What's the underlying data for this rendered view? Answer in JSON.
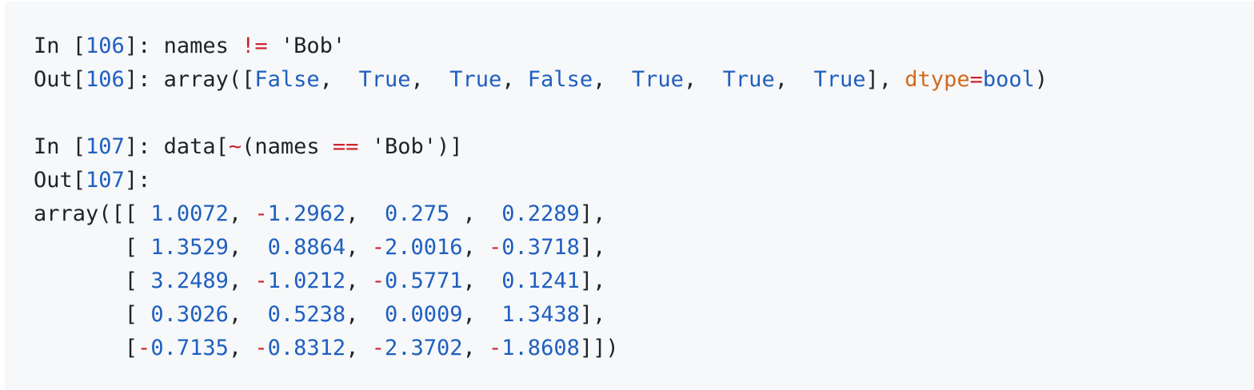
{
  "code": {
    "lines": [
      [
        {
          "t": "In [",
          "c": "p"
        },
        {
          "t": "106",
          "c": "n"
        },
        {
          "t": "]: names ",
          "c": "p"
        },
        {
          "t": "!=",
          "c": "o"
        },
        {
          "t": " 'Bob'",
          "c": "s"
        }
      ],
      [
        {
          "t": "Out[",
          "c": "p"
        },
        {
          "t": "106",
          "c": "n"
        },
        {
          "t": "]: array([",
          "c": "p"
        },
        {
          "t": "False",
          "c": "n"
        },
        {
          "t": ",  ",
          "c": "p"
        },
        {
          "t": "True",
          "c": "n"
        },
        {
          "t": ",  ",
          "c": "p"
        },
        {
          "t": "True",
          "c": "n"
        },
        {
          "t": ", ",
          "c": "p"
        },
        {
          "t": "False",
          "c": "n"
        },
        {
          "t": ",  ",
          "c": "p"
        },
        {
          "t": "True",
          "c": "n"
        },
        {
          "t": ",  ",
          "c": "p"
        },
        {
          "t": "True",
          "c": "n"
        },
        {
          "t": ",  ",
          "c": "p"
        },
        {
          "t": "True",
          "c": "n"
        },
        {
          "t": "], ",
          "c": "p"
        },
        {
          "t": "dtype",
          "c": "k"
        },
        {
          "t": "=",
          "c": "o"
        },
        {
          "t": "bool",
          "c": "n"
        },
        {
          "t": ")",
          "c": "p"
        }
      ],
      [],
      [
        {
          "t": "In [",
          "c": "p"
        },
        {
          "t": "107",
          "c": "n"
        },
        {
          "t": "]: data[",
          "c": "p"
        },
        {
          "t": "~",
          "c": "o"
        },
        {
          "t": "(names ",
          "c": "p"
        },
        {
          "t": "==",
          "c": "o"
        },
        {
          "t": " 'Bob')]",
          "c": "s"
        }
      ],
      [
        {
          "t": "Out[",
          "c": "p"
        },
        {
          "t": "107",
          "c": "n"
        },
        {
          "t": "]:",
          "c": "p"
        }
      ],
      [
        {
          "t": "array([[ ",
          "c": "p"
        },
        {
          "t": "1.0072",
          "c": "n"
        },
        {
          "t": ", ",
          "c": "p"
        },
        {
          "t": "-",
          "c": "o"
        },
        {
          "t": "1.2962",
          "c": "n"
        },
        {
          "t": ",  ",
          "c": "p"
        },
        {
          "t": "0.275",
          "c": "n"
        },
        {
          "t": " ,  ",
          "c": "p"
        },
        {
          "t": "0.2289",
          "c": "n"
        },
        {
          "t": "],",
          "c": "p"
        }
      ],
      [
        {
          "t": "       [ ",
          "c": "p"
        },
        {
          "t": "1.3529",
          "c": "n"
        },
        {
          "t": ",  ",
          "c": "p"
        },
        {
          "t": "0.8864",
          "c": "n"
        },
        {
          "t": ", ",
          "c": "p"
        },
        {
          "t": "-",
          "c": "o"
        },
        {
          "t": "2.0016",
          "c": "n"
        },
        {
          "t": ", ",
          "c": "p"
        },
        {
          "t": "-",
          "c": "o"
        },
        {
          "t": "0.3718",
          "c": "n"
        },
        {
          "t": "],",
          "c": "p"
        }
      ],
      [
        {
          "t": "       [ ",
          "c": "p"
        },
        {
          "t": "3.2489",
          "c": "n"
        },
        {
          "t": ", ",
          "c": "p"
        },
        {
          "t": "-",
          "c": "o"
        },
        {
          "t": "1.0212",
          "c": "n"
        },
        {
          "t": ", ",
          "c": "p"
        },
        {
          "t": "-",
          "c": "o"
        },
        {
          "t": "0.5771",
          "c": "n"
        },
        {
          "t": ",  ",
          "c": "p"
        },
        {
          "t": "0.1241",
          "c": "n"
        },
        {
          "t": "],",
          "c": "p"
        }
      ],
      [
        {
          "t": "       [ ",
          "c": "p"
        },
        {
          "t": "0.3026",
          "c": "n"
        },
        {
          "t": ",  ",
          "c": "p"
        },
        {
          "t": "0.5238",
          "c": "n"
        },
        {
          "t": ",  ",
          "c": "p"
        },
        {
          "t": "0.0009",
          "c": "n"
        },
        {
          "t": ",  ",
          "c": "p"
        },
        {
          "t": "1.3438",
          "c": "n"
        },
        {
          "t": "],",
          "c": "p"
        }
      ],
      [
        {
          "t": "       [",
          "c": "p"
        },
        {
          "t": "-",
          "c": "o"
        },
        {
          "t": "0.7135",
          "c": "n"
        },
        {
          "t": ", ",
          "c": "p"
        },
        {
          "t": "-",
          "c": "o"
        },
        {
          "t": "0.8312",
          "c": "n"
        },
        {
          "t": ", ",
          "c": "p"
        },
        {
          "t": "-",
          "c": "o"
        },
        {
          "t": "2.3702",
          "c": "n"
        },
        {
          "t": ", ",
          "c": "p"
        },
        {
          "t": "-",
          "c": "o"
        },
        {
          "t": "1.8608",
          "c": "n"
        },
        {
          "t": "]])",
          "c": "p"
        }
      ]
    ]
  },
  "colors": {
    "background": "#f6f8fa",
    "text": "#1f2328",
    "number": "#1f5fbf",
    "operator": "#cf222e",
    "keyword": "#d2691e"
  }
}
